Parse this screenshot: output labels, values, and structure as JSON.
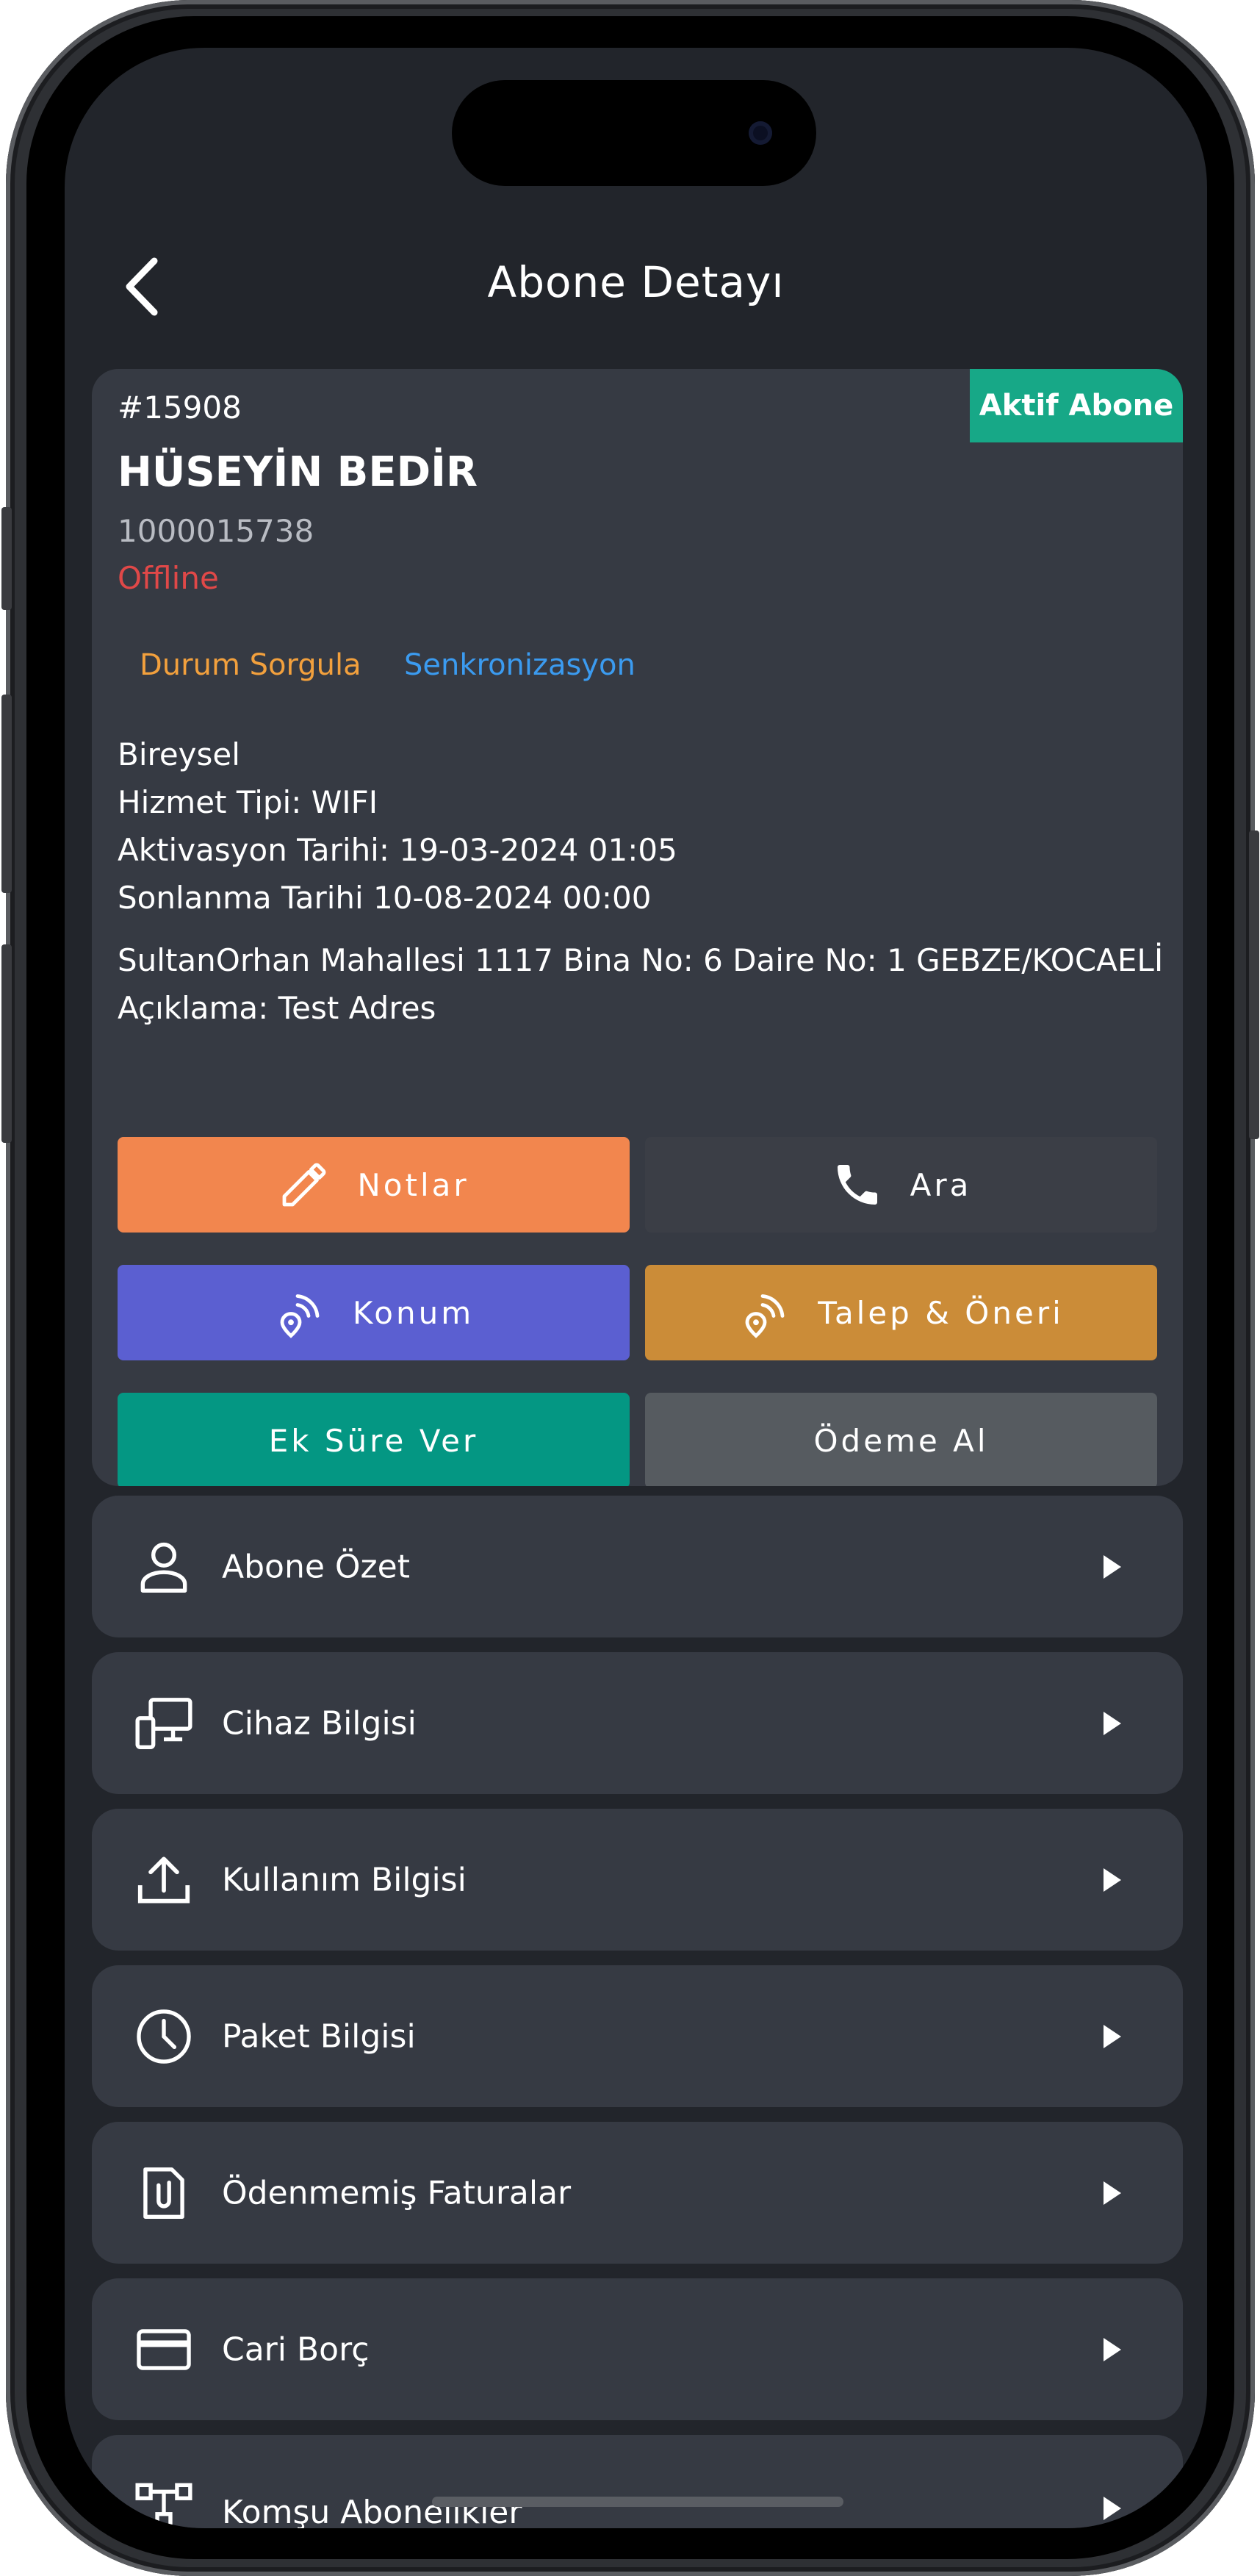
{
  "header": {
    "title": "Abone Detayı",
    "back_icon": "chevron-left-icon"
  },
  "subscriber": {
    "id": "#15908",
    "status_badge": "Aktif Abone",
    "name": "HÜSEYİN BEDİR",
    "number": "1000015738",
    "connection_status": "Offline",
    "links": {
      "status_query": "Durum Sorgula",
      "sync": "Senkronizasyon"
    },
    "type": "Bireysel",
    "service_type": "Hizmet Tipi: WIFI",
    "activation_date": "Aktivasyon Tarihi: 19-03-2024 01:05",
    "expiry_date": "Sonlanma Tarihi 10-08-2024 00:00",
    "address": "SultanOrhan Mahallesi 1117 Bina No: 6 Daire No: 1 GEBZE/KOCAELİ",
    "description": "Açıklama: Test Adres"
  },
  "actions": {
    "notes": "Notlar",
    "call": "Ara",
    "location": "Konum",
    "request": "Talep & Öneri",
    "extend": "Ek Süre Ver",
    "payment": "Ödeme Al"
  },
  "menu": [
    {
      "label": "Abone Özet",
      "icon": "person-icon"
    },
    {
      "label": "Cihaz Bilgisi",
      "icon": "devices-icon"
    },
    {
      "label": "Kullanım Bilgisi",
      "icon": "upload-icon"
    },
    {
      "label": "Paket Bilgisi",
      "icon": "clock-icon"
    },
    {
      "label": "Ödenmemiş Faturalar",
      "icon": "document-icon"
    },
    {
      "label": "Cari Borç",
      "icon": "credit-card-icon"
    },
    {
      "label": "Komşu Abonelikler",
      "icon": "network-icon"
    }
  ],
  "colors": {
    "background": "#22252b",
    "card": "#363a43",
    "badge": "#17a887",
    "offline": "#e04848",
    "link_orange": "#f2a03d",
    "link_blue": "#3b9bf0",
    "notes": "#f2864e",
    "location": "#5b5fd1",
    "request": "#cb8c38",
    "extend": "#049783",
    "payment": "#565b60"
  }
}
